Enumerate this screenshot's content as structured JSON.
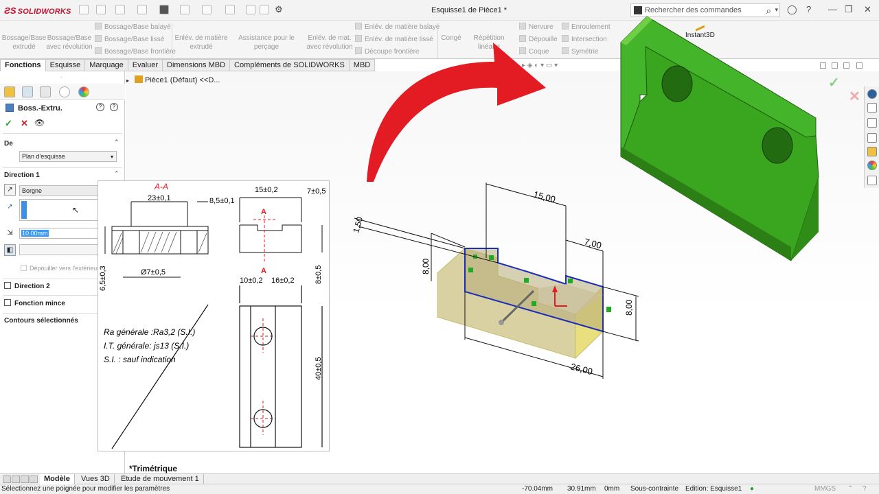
{
  "app": {
    "logo_text": "SOLIDWORKS",
    "document_title": "Esquisse1 de Pièce1 *",
    "search_placeholder": "Rechercher des commandes"
  },
  "ribbon": {
    "big": [
      "Bossage/Base\nextrudé",
      "Bossage/Base\navec révolution",
      "Enlév. de matière\nextrudé",
      "Assistance pour le perçage",
      "Enlév. de mat.\navec révolution",
      "Congé",
      "Répétition linéaire"
    ],
    "small_col1": [
      "Bossage/Base balayé",
      "Bossage/Base lissé",
      "Bossage/Base frontière"
    ],
    "small_col2": [
      "Enlév. de matière balayé",
      "Enlév. de matière lissé",
      "Découpe frontière"
    ],
    "small_col3": [
      "Nervure",
      "Dépouille",
      "Coque"
    ],
    "small_col4": [
      "Enroulement",
      "Intersection",
      "Symétrie"
    ],
    "instant3d": "Instant3D"
  },
  "tabs": [
    "Fonctions",
    "Esquisse",
    "Marquage",
    "Evaluer",
    "Dimensions MBD",
    "Compléments de SOLIDWORKS",
    "MBD"
  ],
  "property_manager": {
    "title": "Boss.-Extru.",
    "from_label": "De",
    "from_value": "Plan d'esquisse",
    "direction1_label": "Direction 1",
    "end_condition": "Borgne",
    "depth": "10.00mm",
    "draft_outward": "Dépouiller vers l'extérieur",
    "direction2_label": "Direction 2",
    "thin_feature_label": "Fonction mince",
    "selected_contours_label": "Contours sélectionnés"
  },
  "tree": {
    "root": "Pièce1 (Défaut) <<D..."
  },
  "drawing": {
    "section_label": "A-A",
    "dims": [
      "23±0,1",
      "8,5±0,1",
      "15±0,2",
      "7±0,5",
      "Ø7±0,5",
      "6,5±0,3",
      "8±0,5",
      "10±0,2",
      "16±0,2",
      "40±0,5",
      "A",
      "A"
    ],
    "notes": [
      "Ra générale :Ra3,2 (S.I.)",
      "I.T. générale: js13 (S.I.)",
      "S.I. : sauf indication"
    ]
  },
  "sketch_dims": [
    "15,00",
    "7,00",
    "1,50",
    "8,00",
    "8,00",
    "26,00"
  ],
  "viewport": {
    "orientation": "*Trimétrique"
  },
  "bottom_tabs": [
    "Modèle",
    "Vues 3D",
    "Etude de mouvement 1"
  ],
  "status": {
    "message": "Sélectionnez une poignée pour modifier les paramètres",
    "x": "-70.04mm",
    "y": "30.91mm",
    "z": "0mm",
    "state": "Sous-contrainte",
    "edition": "Edition: Esquisse1",
    "units": "MMGS"
  },
  "colors": {
    "model_green": "#3aa51e",
    "arrow_red": "#e31b23",
    "sketch_blue": "#1a2fb5",
    "extrude_yellow": "#e8e07a"
  }
}
